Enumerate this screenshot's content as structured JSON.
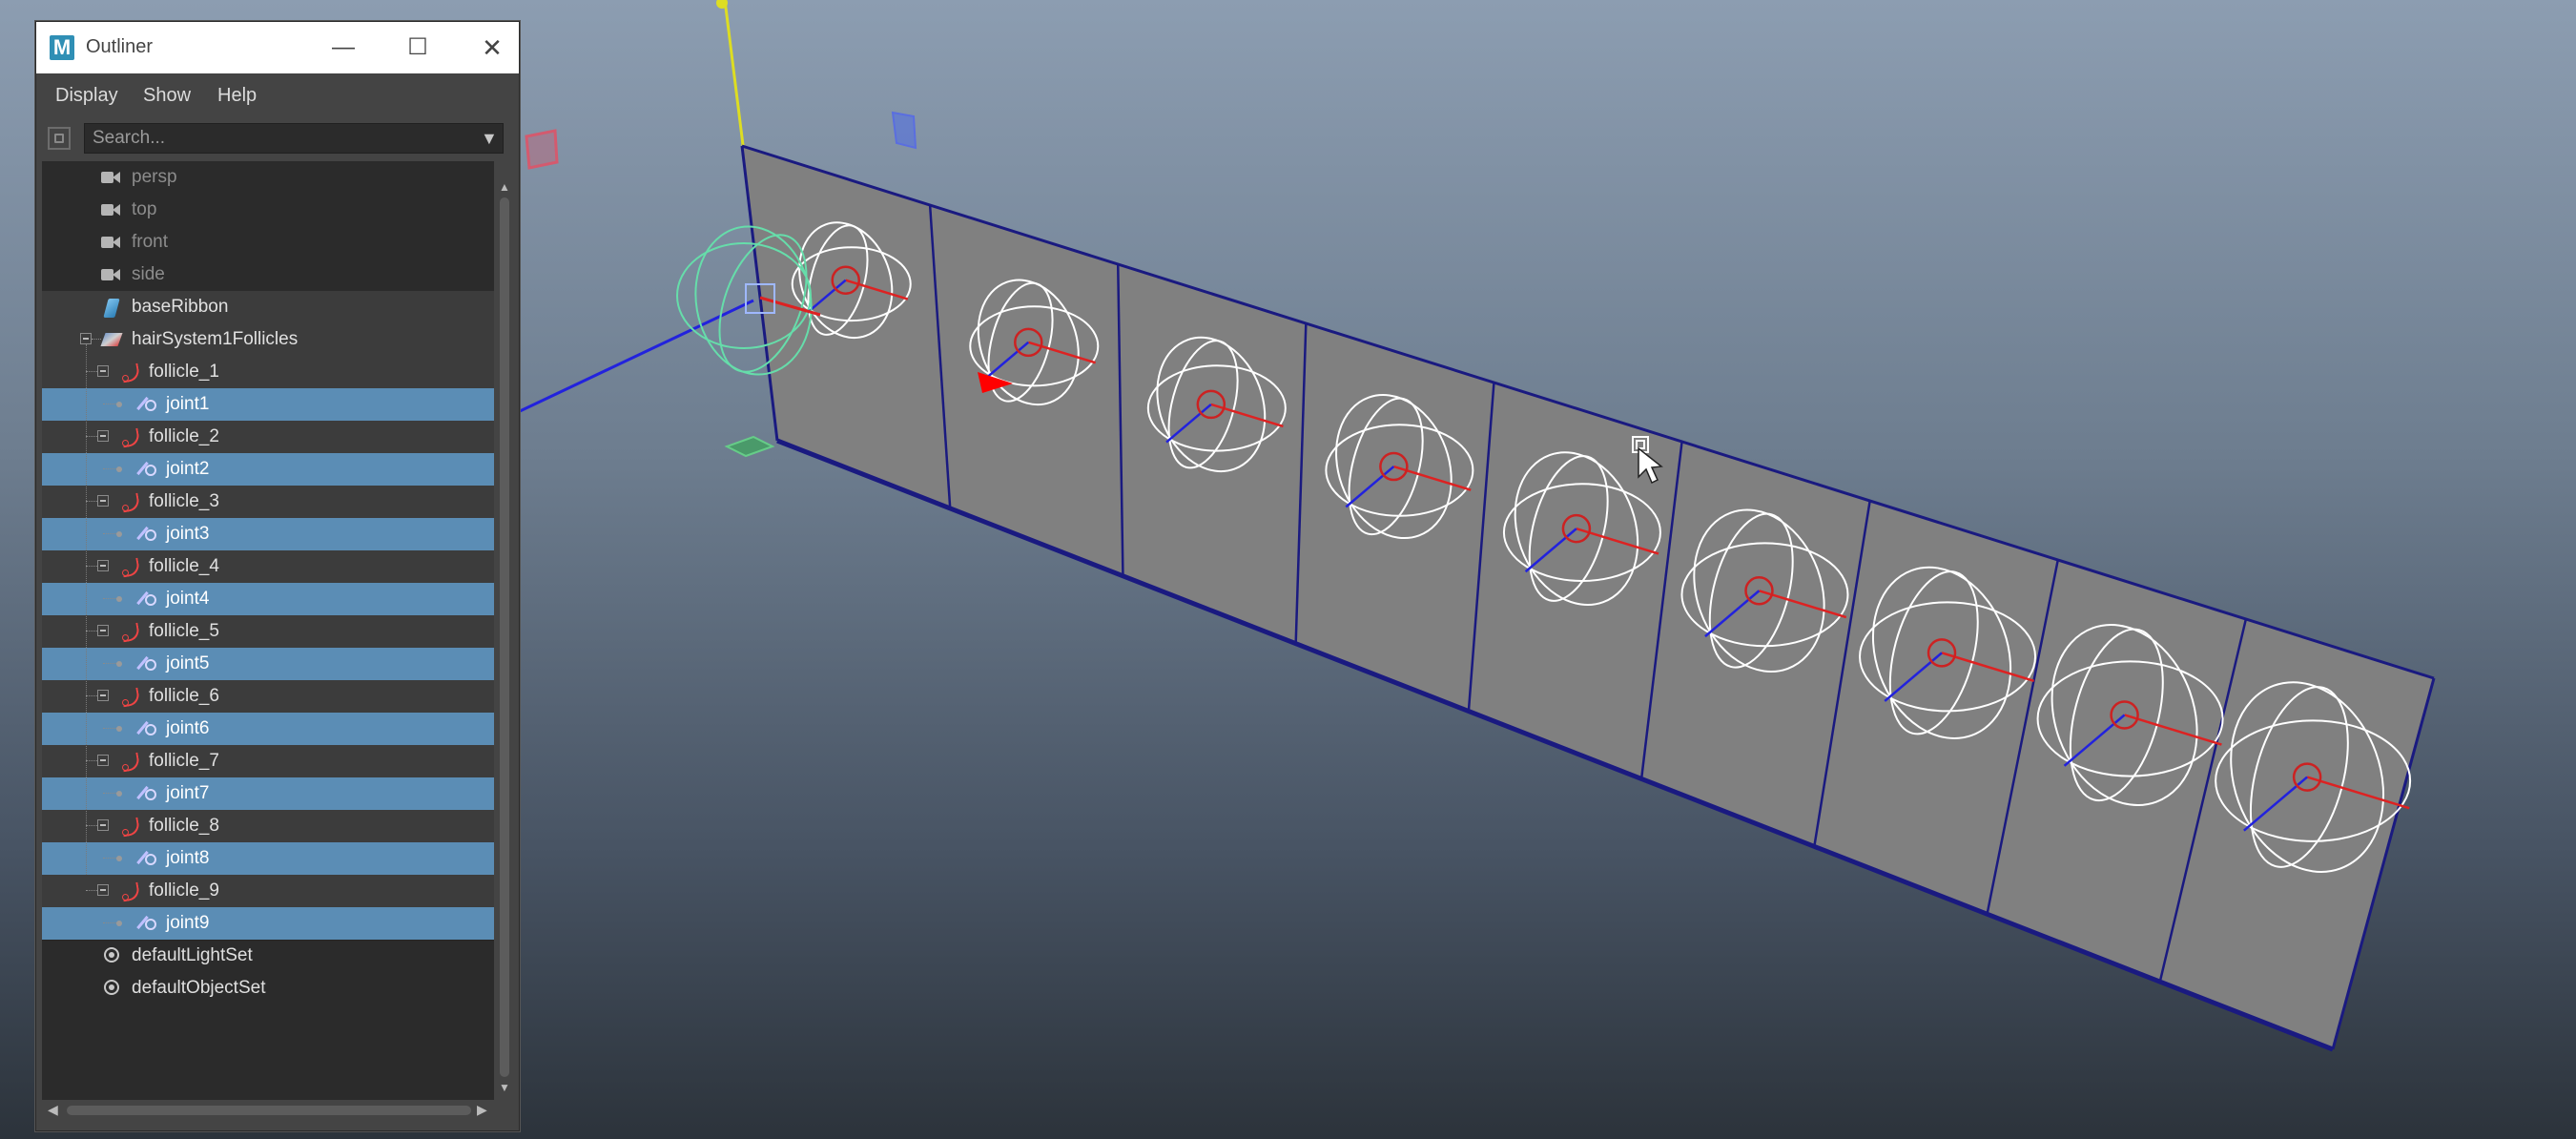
{
  "window": {
    "title": "Outliner",
    "app_icon_letter": "M",
    "minimize_glyph": "—",
    "maximize_glyph": "☐",
    "close_glyph": "✕"
  },
  "menu": {
    "display": "Display",
    "show": "Show",
    "help": "Help"
  },
  "search": {
    "placeholder": "Search...",
    "value": ""
  },
  "tree": {
    "persp": "persp",
    "top": "top",
    "front": "front",
    "side": "side",
    "base_ribbon": "baseRibbon",
    "hair_system": "hairSystem1Follicles",
    "follicles": [
      {
        "follicle": "follicle_1",
        "joint": "joint1"
      },
      {
        "follicle": "follicle_2",
        "joint": "joint2"
      },
      {
        "follicle": "follicle_3",
        "joint": "joint3"
      },
      {
        "follicle": "follicle_4",
        "joint": "joint4"
      },
      {
        "follicle": "follicle_5",
        "joint": "joint5"
      },
      {
        "follicle": "follicle_6",
        "joint": "joint6"
      },
      {
        "follicle": "follicle_7",
        "joint": "joint7"
      },
      {
        "follicle": "follicle_8",
        "joint": "joint8"
      },
      {
        "follicle": "follicle_9",
        "joint": "joint9"
      }
    ],
    "default_light_set": "defaultLightSet",
    "default_object_set": "defaultObjectSet"
  },
  "colors": {
    "selection_highlight": "#5b8db5",
    "outliner_bg": "#2b2b2b",
    "ribbon_surface": "#808080",
    "ribbon_edge": "#1a1a80",
    "joint_circle": "#cc2222",
    "axis_x": "#dd2222",
    "axis_y": "#dddd22",
    "axis_z": "#2222dd",
    "selected_control": "#66ddaa"
  },
  "icons": {
    "camera": "camera-icon",
    "nurbs": "nurbs-surface-icon",
    "hair_system": "hair-system-icon",
    "follicle": "follicle-icon",
    "joint": "joint-icon",
    "set": "object-set-icon"
  }
}
